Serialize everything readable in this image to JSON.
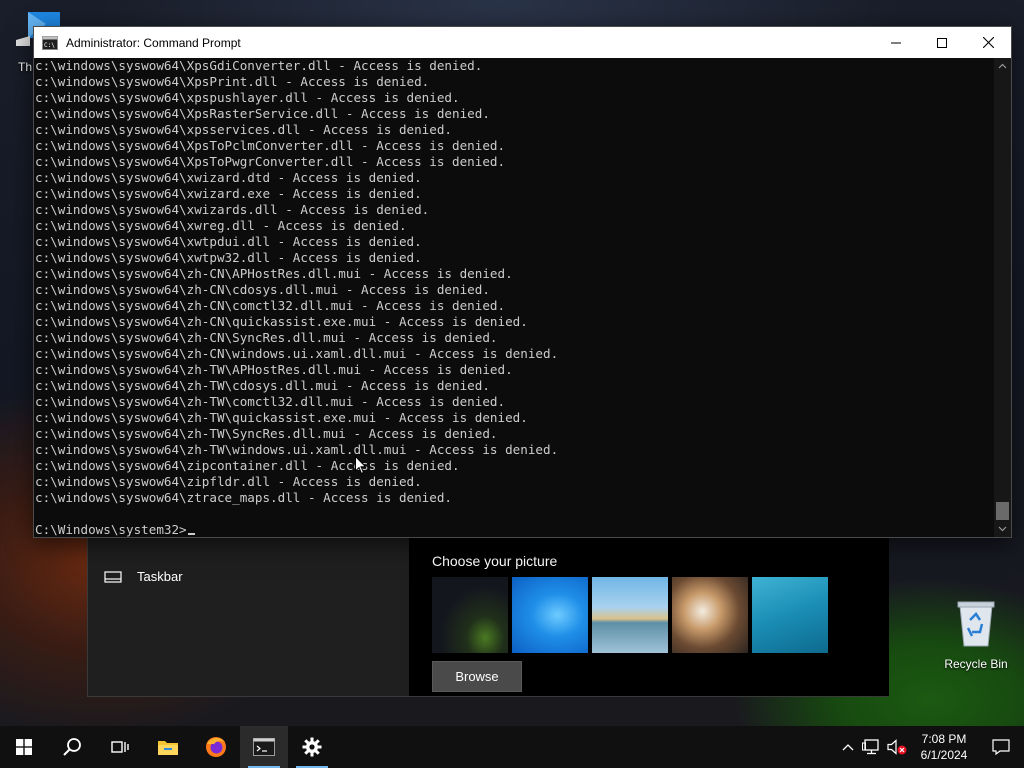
{
  "desktop": {
    "partial_icon_label": "Th",
    "recycle_bin_label": "Recycle Bin"
  },
  "settings": {
    "nav_item_label": "Taskbar",
    "choose_picture_title": "Choose your picture",
    "browse_label": "Browse"
  },
  "cmd": {
    "title": "Administrator: Command Prompt",
    "lines": [
      "c:\\windows\\syswow64\\XpsGdiConverter.dll - Access is denied.",
      "c:\\windows\\syswow64\\XpsPrint.dll - Access is denied.",
      "c:\\windows\\syswow64\\xpspushlayer.dll - Access is denied.",
      "c:\\windows\\syswow64\\XpsRasterService.dll - Access is denied.",
      "c:\\windows\\syswow64\\xpsservices.dll - Access is denied.",
      "c:\\windows\\syswow64\\XpsToPclmConverter.dll - Access is denied.",
      "c:\\windows\\syswow64\\XpsToPwgrConverter.dll - Access is denied.",
      "c:\\windows\\syswow64\\xwizard.dtd - Access is denied.",
      "c:\\windows\\syswow64\\xwizard.exe - Access is denied.",
      "c:\\windows\\syswow64\\xwizards.dll - Access is denied.",
      "c:\\windows\\syswow64\\xwreg.dll - Access is denied.",
      "c:\\windows\\syswow64\\xwtpdui.dll - Access is denied.",
      "c:\\windows\\syswow64\\xwtpw32.dll - Access is denied.",
      "c:\\windows\\syswow64\\zh-CN\\APHostRes.dll.mui - Access is denied.",
      "c:\\windows\\syswow64\\zh-CN\\cdosys.dll.mui - Access is denied.",
      "c:\\windows\\syswow64\\zh-CN\\comctl32.dll.mui - Access is denied.",
      "c:\\windows\\syswow64\\zh-CN\\quickassist.exe.mui - Access is denied.",
      "c:\\windows\\syswow64\\zh-CN\\SyncRes.dll.mui - Access is denied.",
      "c:\\windows\\syswow64\\zh-CN\\windows.ui.xaml.dll.mui - Access is denied.",
      "c:\\windows\\syswow64\\zh-TW\\APHostRes.dll.mui - Access is denied.",
      "c:\\windows\\syswow64\\zh-TW\\cdosys.dll.mui - Access is denied.",
      "c:\\windows\\syswow64\\zh-TW\\comctl32.dll.mui - Access is denied.",
      "c:\\windows\\syswow64\\zh-TW\\quickassist.exe.mui - Access is denied.",
      "c:\\windows\\syswow64\\zh-TW\\SyncRes.dll.mui - Access is denied.",
      "c:\\windows\\syswow64\\zh-TW\\windows.ui.xaml.dll.mui - Access is denied.",
      "c:\\windows\\syswow64\\zipcontainer.dll - Access is denied.",
      "c:\\windows\\syswow64\\zipfldr.dll - Access is denied.",
      "c:\\windows\\syswow64\\ztrace_maps.dll - Access is denied.",
      ""
    ],
    "prompt": "C:\\Windows\\system32>"
  },
  "taskbar": {
    "time": "7:08 PM",
    "date": "6/1/2024",
    "items": [
      "start",
      "search",
      "task-view",
      "file-explorer",
      "firefox",
      "command-prompt",
      "settings"
    ],
    "active_item": "command-prompt",
    "accent": "#76b9ed"
  },
  "colors": {
    "console_bg": "#0c0c0c",
    "console_fg": "#cccccc",
    "taskbar_bg": "#101010"
  }
}
